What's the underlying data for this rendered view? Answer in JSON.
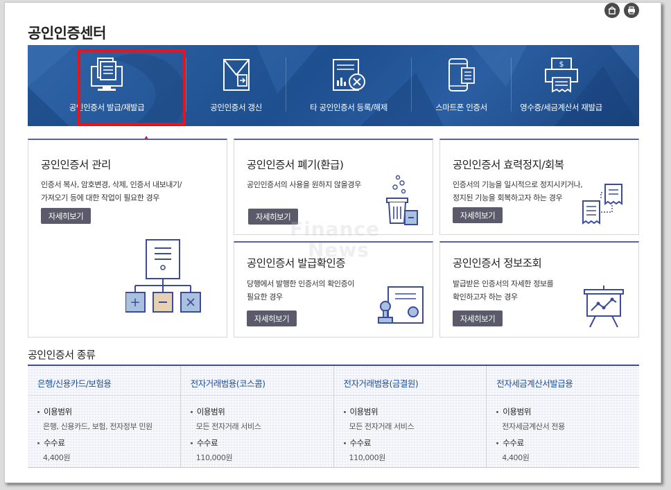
{
  "page": {
    "title": "공인인증센터"
  },
  "banner": {
    "items": [
      {
        "label": "공인인증서 발급/재발급",
        "icon": "monitor-document-icon"
      },
      {
        "label": "공인인증서 갱신",
        "icon": "envelope-renew-icon"
      },
      {
        "label": "타 공인인증서 등록/해제",
        "icon": "chart-cancel-icon"
      },
      {
        "label": "스마트폰 인증서",
        "icon": "smartphone-icon"
      },
      {
        "label": "영수증/세금계산서 재발급",
        "icon": "printer-receipt-icon"
      }
    ]
  },
  "cards": {
    "manage": {
      "title": "공인인증서 관리",
      "desc1": "인증서 복사, 암호변경, 삭제, 인증서 내보내기/",
      "desc2": "가져오기 등에 대한 작업이 필요한 경우",
      "button": "자세히보기"
    },
    "revoke": {
      "title": "공인인증서 폐기(환급)",
      "desc1": "공인인증서의 사용을 원하지 않을경우",
      "button": "자세히보기"
    },
    "suspend": {
      "title": "공인인증서 효력정지/회복",
      "desc1": "인증서의 기능을 일시적으로 정지시키거나,",
      "desc2": "정지된 기능을 회복하고자 하는 경우",
      "button": "자세히보기"
    },
    "confirm": {
      "title": "공인인증서 발급확인증",
      "desc1": "당행에서 발행한 인증서의 확인증이",
      "desc2": "필요한 경우",
      "button": "자세히보기"
    },
    "info": {
      "title": "공인인증서 정보조회",
      "desc1": "발급받은 인증서의 자세한 정보를",
      "desc2": "확인하고자 하는 경우",
      "button": "자세히보기"
    }
  },
  "watermark": {
    "line1": "Finance",
    "line2": "News"
  },
  "types": {
    "title": "공인인증서 종류",
    "scope_label": "이용범위",
    "fee_label": "수수료",
    "columns": [
      {
        "name": "은행/신용카드/보험용",
        "scope": "은행, 신용카드, 보험, 전자정부 민원",
        "fee": "4,400원"
      },
      {
        "name": "전자거래범용(코스콤)",
        "scope": "모든 전자거래 서비스",
        "fee": "110,000원"
      },
      {
        "name": "전자거래범용(금결원)",
        "scope": "모든 전자거래 서비스",
        "fee": "110,000원"
      },
      {
        "name": "전자세금계산서발급용",
        "scope": "전자세금계산서 전용",
        "fee": "4,400원"
      }
    ]
  },
  "colors": {
    "accent": "#3b4a9a",
    "highlight": "#e8131b",
    "banner": "#2a5a9c",
    "button": "#5a5a6a"
  }
}
